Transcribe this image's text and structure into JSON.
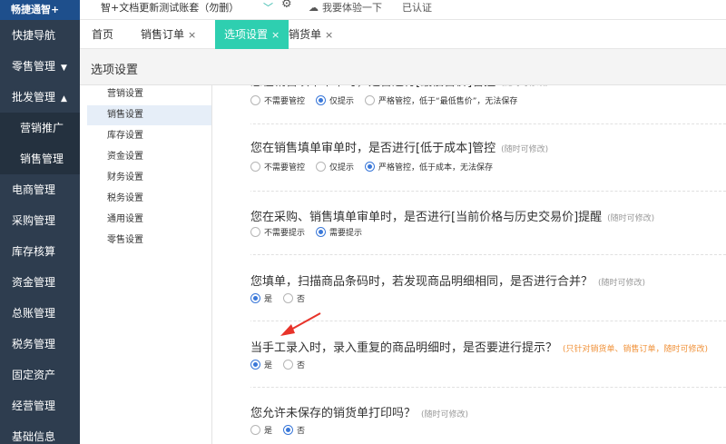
{
  "app": {
    "logo": "畅捷通智+"
  },
  "topbar": {
    "account": "智+文档更新测试账套（勿删）",
    "experience": "我要体验一下",
    "certified": "已认证"
  },
  "sidebar": {
    "items": [
      {
        "label": "快捷导航"
      },
      {
        "label": "零售管理",
        "caret": "▼"
      },
      {
        "label": "批发管理",
        "caret": "▲"
      },
      {
        "label": "营销推广",
        "sub": true
      },
      {
        "label": "销售管理",
        "sub": true
      },
      {
        "label": "电商管理"
      },
      {
        "label": "采购管理"
      },
      {
        "label": "库存核算"
      },
      {
        "label": "资金管理"
      },
      {
        "label": "总账管理"
      },
      {
        "label": "税务管理"
      },
      {
        "label": "固定资产"
      },
      {
        "label": "经营管理"
      },
      {
        "label": "基础信息"
      }
    ]
  },
  "tabs": [
    {
      "label": "首页",
      "closable": false
    },
    {
      "label": "销售订单",
      "closable": true
    },
    {
      "label": "选项设置",
      "closable": true,
      "active": true
    },
    {
      "label": "销货单",
      "closable": true
    }
  ],
  "tab_close_glyph": "×",
  "page": {
    "title": "选项设置"
  },
  "menu": {
    "items": [
      {
        "label": "营销设置"
      },
      {
        "label": "销售设置",
        "active": true
      },
      {
        "label": "库存设置"
      },
      {
        "label": "资金设置"
      },
      {
        "label": "财务设置"
      },
      {
        "label": "税务设置"
      },
      {
        "label": "通用设置"
      },
      {
        "label": "零售设置"
      }
    ]
  },
  "settings": [
    {
      "question": "您在销售填单审单时，是否进行[最低售价]管控",
      "hint": "(随时可修改)",
      "hint_color": "gray",
      "options": [
        {
          "label": "不需要管控",
          "checked": false
        },
        {
          "label": "仅提示",
          "checked": true
        },
        {
          "label": "严格管控，低于“最低售价”，无法保存",
          "checked": false
        }
      ]
    },
    {
      "question": "您在销售填单审单时，是否进行[低于成本]管控",
      "hint": "(随时可修改)",
      "hint_color": "gray",
      "options": [
        {
          "label": "不需要管控",
          "checked": false
        },
        {
          "label": "仅提示",
          "checked": false
        },
        {
          "label": "严格管控，低于成本，无法保存",
          "checked": true
        }
      ]
    },
    {
      "question": "您在采购、销售填单审单时，是否进行[当前价格与历史交易价]提醒",
      "hint": "(随时可修改)",
      "hint_color": "gray",
      "options": [
        {
          "label": "不需要提示",
          "checked": false
        },
        {
          "label": "需要提示",
          "checked": true
        }
      ]
    },
    {
      "question": "您填单，扫描商品条码时，若发现商品明细相同，是否进行合并？",
      "hint": "(随时可修改)",
      "hint_color": "gray",
      "options": [
        {
          "label": "是",
          "checked": true
        },
        {
          "label": "否",
          "checked": false
        }
      ]
    },
    {
      "question": "当手工录入时，录入重复的商品明细时，是否要进行提示？",
      "hint": "(只针对销货单、销售订单，随时可修改)",
      "hint_color": "orange",
      "options": [
        {
          "label": "是",
          "checked": true
        },
        {
          "label": "否",
          "checked": false
        }
      ]
    },
    {
      "question": "您允许未保存的销货单打印吗？",
      "hint": "(随时可修改)",
      "hint_color": "gray",
      "options": [
        {
          "label": "是",
          "checked": false
        },
        {
          "label": "否",
          "checked": true
        }
      ]
    }
  ],
  "colors": {
    "sidebar_bg": "#2e3d4f",
    "active_tab": "#2ecfb0",
    "radio_checked": "#3a78d9",
    "hint_orange": "#f0923a",
    "arrow": "#e8332a"
  },
  "icons": {
    "gear": "gear-icon",
    "experience": "cloud-hand-icon",
    "dropdown": "chevron-down-icon"
  }
}
